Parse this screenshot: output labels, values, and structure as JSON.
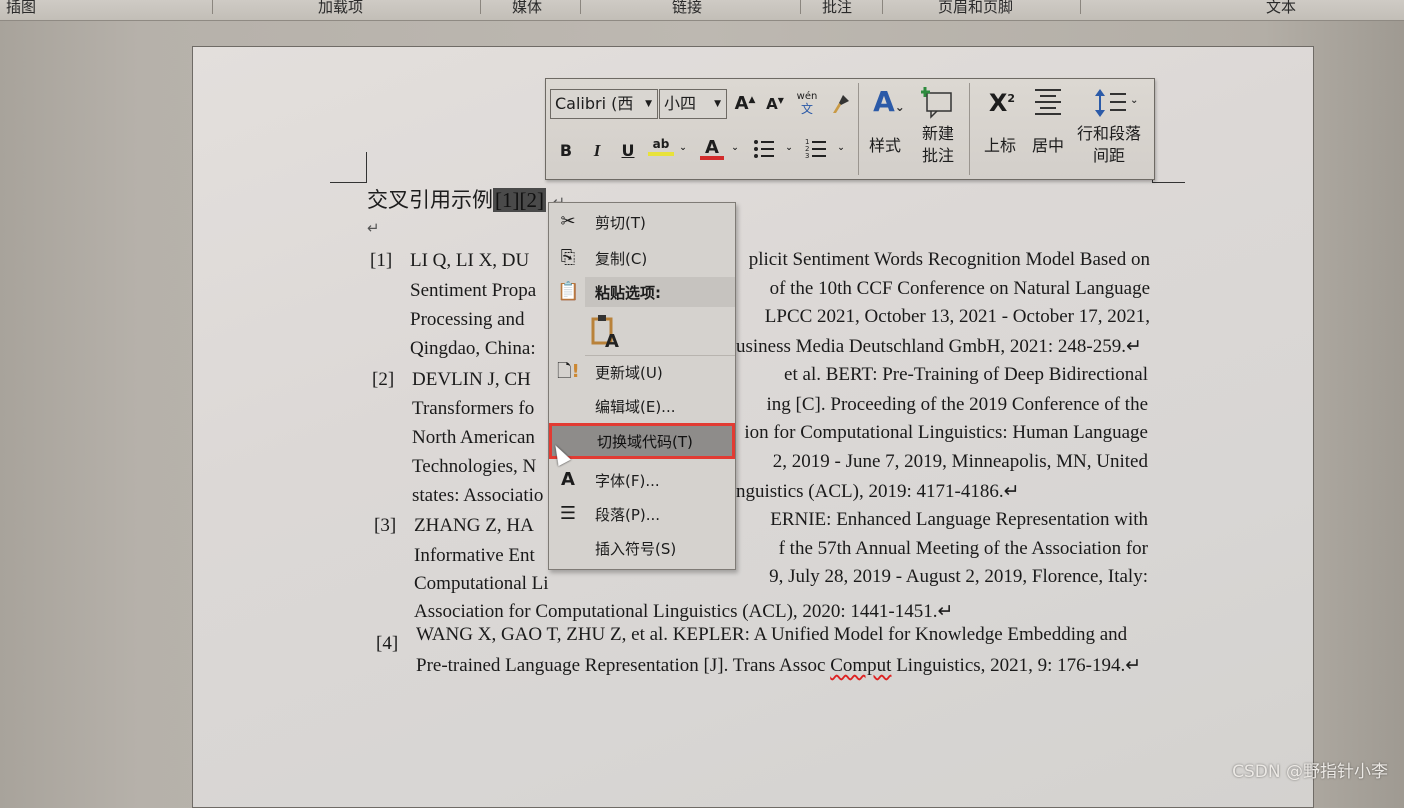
{
  "ribbon_groups": [
    "插图",
    "加载项",
    "媒体",
    "链接",
    "批注",
    "页眉和页脚",
    "文本"
  ],
  "document": {
    "heading_text": "交叉引用示例",
    "heading_field": "[1][2]",
    "paragraph_mark": "↵",
    "references": [
      {
        "num": "[1]",
        "lines": [
          {
            "left": "LI Q, LI X, DU",
            "right": "plicit Sentiment Words Recognition Model Based on"
          },
          {
            "left": "Sentiment Propa",
            "right": "of the 10th CCF Conference on Natural Language"
          },
          {
            "left": "Processing and",
            "right": "LPCC 2021, October 13, 2021 - October 17, 2021,"
          },
          {
            "left": "Qingdao, China:",
            "right": "usiness Media Deutschland GmbH, 2021: 248-259.↵"
          }
        ]
      },
      {
        "num": "[2]",
        "lines": [
          {
            "left": "DEVLIN J, CH",
            "right": "et al. BERT: Pre-Training of Deep Bidirectional"
          },
          {
            "left": "Transformers fo",
            "right": "ing [C]. Proceeding of the 2019 Conference of the"
          },
          {
            "left": "North American",
            "right": "ion for Computational Linguistics: Human Language"
          },
          {
            "left": "Technologies, N",
            "right": "2, 2019 - June 7, 2019, Minneapolis, MN, United"
          },
          {
            "left": "states: Associatio",
            "right": "nguistics (ACL), 2019: 4171-4186.↵"
          }
        ]
      },
      {
        "num": "[3]",
        "lines": [
          {
            "left": "ZHANG Z, HA",
            "right": "ERNIE: Enhanced Language Representation with"
          },
          {
            "left": "Informative Ent",
            "right": "f the 57th Annual Meeting of the Association for"
          },
          {
            "left": "Computational Li",
            "right": "9, July 28, 2019 - August 2, 2019, Florence, Italy:"
          },
          {
            "left": "Association for Computational Linguistics (ACL), 2020: 1441-1451.↵",
            "right": ""
          }
        ]
      },
      {
        "num": "[4]",
        "lines": [
          {
            "left": "WANG X, GAO T, ZHU Z, et al. KEPLER: A Unified Model for Knowledge Embedding and",
            "right": ""
          },
          {
            "left_a": "Pre-trained Language Representation [J]. Trans Assoc ",
            "left_misspelled": "Comput",
            "left_b": " Linguistics, 2021, 9: 176-194.↵"
          }
        ]
      }
    ]
  },
  "mini_toolbar": {
    "font_name": "Calibri (西",
    "font_size": "小四",
    "grow_font": "A",
    "shrink_font": "A",
    "phonetic_top": "wén",
    "phonetic_bottom": "文",
    "bold": "B",
    "italic": "I",
    "underline": "U",
    "highlight": "ab",
    "font_color": "A",
    "styles_label": "样式",
    "new_comment_label_1": "新建",
    "new_comment_label_2": "批注",
    "superscript_label": "上标",
    "superscript_glyph": "X",
    "superscript_exp": "2",
    "center_label": "居中",
    "line_spacing_label_1": "行和段落",
    "line_spacing_label_2": "间距",
    "colors": {
      "highlight": "#e8e23a",
      "font_color": "#d22b2b",
      "accent_blue": "#2b5aa8",
      "accent_green": "#2e8b3e"
    }
  },
  "context_menu": {
    "items": [
      {
        "label": "剪切(T)",
        "icon": "scissors-icon"
      },
      {
        "label": "复制(C)",
        "icon": "copy-icon"
      },
      {
        "label": "粘贴选项:",
        "icon": "paste-icon"
      },
      {
        "label": "",
        "icon": "paste-text-only-icon"
      },
      {
        "label": "更新域(U)",
        "icon": "update-field-icon"
      },
      {
        "label": "编辑域(E)...",
        "icon": ""
      },
      {
        "label": "切换域代码(T)",
        "icon": ""
      },
      {
        "label": "字体(F)...",
        "icon": "font-icon"
      },
      {
        "label": "段落(P)...",
        "icon": "paragraph-icon"
      },
      {
        "label": "插入符号(S)",
        "icon": ""
      }
    ],
    "highlighted_index": 6,
    "highlight_border_color": "#e23b33"
  },
  "watermark": "CSDN @野指针小李"
}
